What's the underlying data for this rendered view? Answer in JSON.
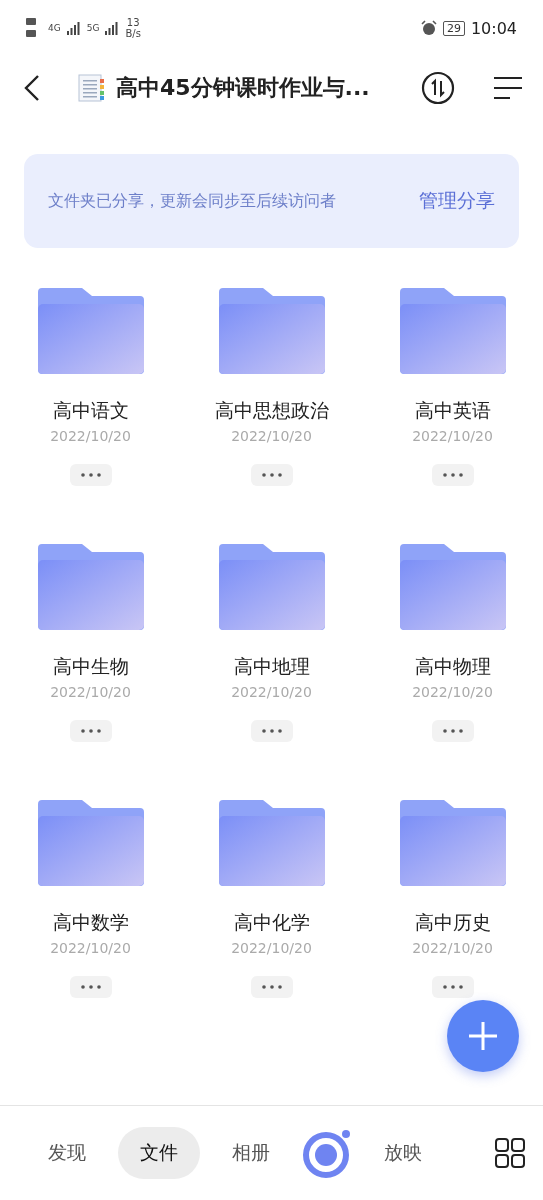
{
  "status_bar": {
    "network_1": "4G",
    "network_2": "5G",
    "speed_value": "13",
    "speed_unit": "B/s",
    "battery": "29",
    "time": "10:04"
  },
  "header": {
    "title": "高中45分钟课时作业与..."
  },
  "share_banner": {
    "message": "文件夹已分享，更新会同步至后续访问者",
    "action": "管理分享"
  },
  "folders": [
    {
      "name": "高中语文",
      "date": "2022/10/20"
    },
    {
      "name": "高中思想政治",
      "date": "2022/10/20"
    },
    {
      "name": "高中英语",
      "date": "2022/10/20"
    },
    {
      "name": "高中生物",
      "date": "2022/10/20"
    },
    {
      "name": "高中地理",
      "date": "2022/10/20"
    },
    {
      "name": "高中物理",
      "date": "2022/10/20"
    },
    {
      "name": "高中数学",
      "date": "2022/10/20"
    },
    {
      "name": "高中化学",
      "date": "2022/10/20"
    },
    {
      "name": "高中历史",
      "date": "2022/10/20"
    }
  ],
  "tabs": [
    {
      "kind": "text",
      "label": "发现",
      "selected": false
    },
    {
      "kind": "text",
      "label": "文件",
      "selected": true
    },
    {
      "kind": "text",
      "label": "相册",
      "selected": false
    },
    {
      "kind": "logo",
      "selected": false
    },
    {
      "kind": "text",
      "label": "放映",
      "selected": false
    }
  ]
}
